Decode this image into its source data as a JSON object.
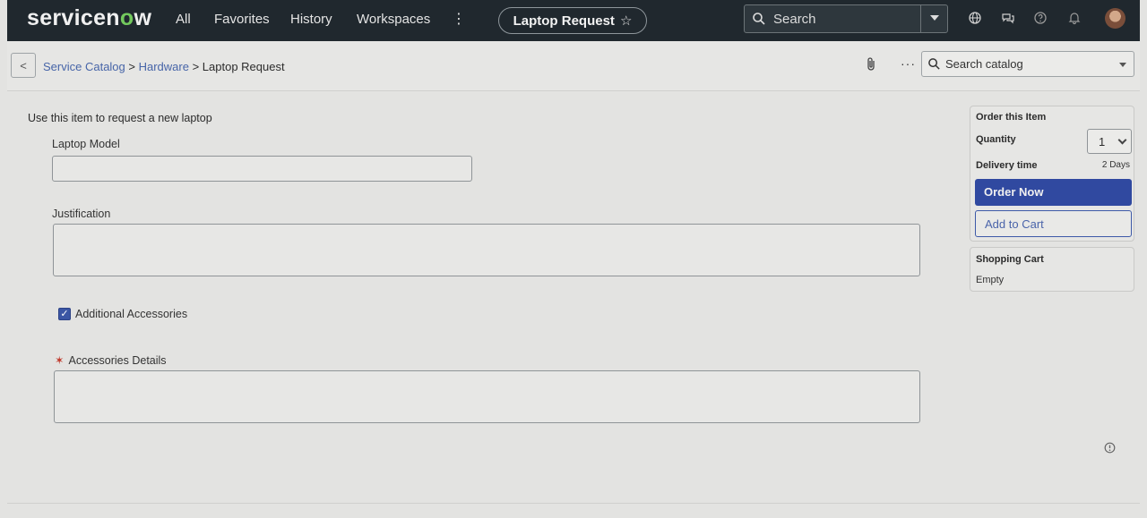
{
  "nav": {
    "logo_prefix": "servicen",
    "logo_o": "o",
    "logo_suffix": "w",
    "items": [
      "All",
      "Favorites",
      "History",
      "Workspaces"
    ],
    "more_glyph": "⋮",
    "page_title": "Laptop Request",
    "star_glyph": "☆",
    "search_placeholder": "Search",
    "icons": [
      "globe-icon",
      "chat-icon",
      "help-icon",
      "bell-icon",
      "avatar"
    ]
  },
  "subheader": {
    "back_glyph": "<",
    "breadcrumbs": [
      "Service Catalog",
      "Hardware",
      "Laptop Request"
    ],
    "separator": " > ",
    "more_glyph": "···",
    "catalog_search_placeholder": "Search catalog"
  },
  "form": {
    "intro": "Use this item to request a new laptop",
    "laptop_model_label": "Laptop Model",
    "laptop_model_value": "",
    "justification_label": "Justification",
    "justification_value": "",
    "accessories_checkbox_label": "Additional Accessories",
    "accessories_checked": true,
    "check_glyph": "✓",
    "required_glyph": "✶",
    "accessories_details_label": "Accessories Details",
    "accessories_details_value": ""
  },
  "order": {
    "heading": "Order this Item",
    "quantity_label": "Quantity",
    "quantity_value": "1",
    "delivery_label": "Delivery time",
    "delivery_value": "2 Days",
    "order_now": "Order Now",
    "add_to_cart": "Add to Cart"
  },
  "cart": {
    "heading": "Shopping Cart",
    "status": "Empty"
  },
  "colors": {
    "nav_bg": "#20282e",
    "brand_green": "#73c95d",
    "primary_button": "#3049a0",
    "link": "#4765a8"
  }
}
